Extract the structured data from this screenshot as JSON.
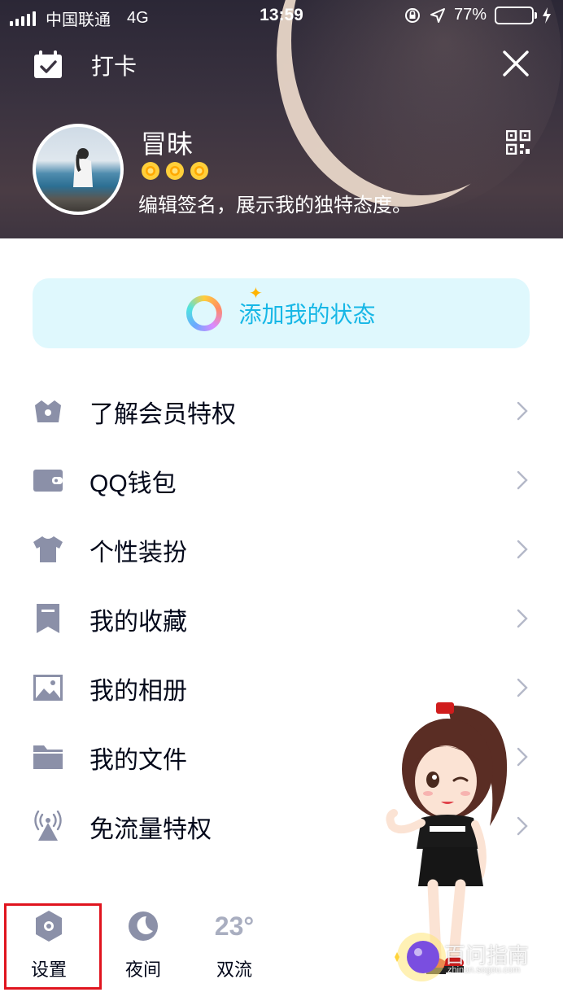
{
  "status_bar": {
    "carrier": "中国联通",
    "network": "4G",
    "time": "13:59",
    "battery": "77%",
    "battery_level": 0.77
  },
  "header": {
    "checkin_label": "打卡",
    "checkin_icon": "calendar-check-icon",
    "close_icon": "close-icon",
    "qr_icon": "qr-code-icon"
  },
  "profile": {
    "nickname": "冒昧",
    "level_suns": 3,
    "signature": "编辑签名，展示我的独特态度。"
  },
  "status_pill": {
    "label": "添加我的状态",
    "accent_color": "#17b7e6",
    "background_color": "#dff8fd"
  },
  "menu": {
    "items": [
      {
        "label": "了解会员特权",
        "icon": "crown-basket-icon"
      },
      {
        "label": "QQ钱包",
        "icon": "wallet-icon"
      },
      {
        "label": "个性装扮",
        "icon": "tshirt-icon"
      },
      {
        "label": "我的收藏",
        "icon": "bookmark-icon"
      },
      {
        "label": "我的相册",
        "icon": "photo-icon"
      },
      {
        "label": "我的文件",
        "icon": "folder-icon"
      },
      {
        "label": "免流量特权",
        "icon": "signal-tower-icon"
      }
    ]
  },
  "bottom": {
    "settings": "设置",
    "night": "夜间",
    "weather_temp": "23°",
    "weather_city": "双流",
    "highlight_color": "#e0141e"
  },
  "watermark": {
    "text": "百问指南",
    "subtext": "zhinan.sogou.com"
  },
  "colors": {
    "icon_gray": "#8b90a8",
    "text": "#03081a"
  }
}
